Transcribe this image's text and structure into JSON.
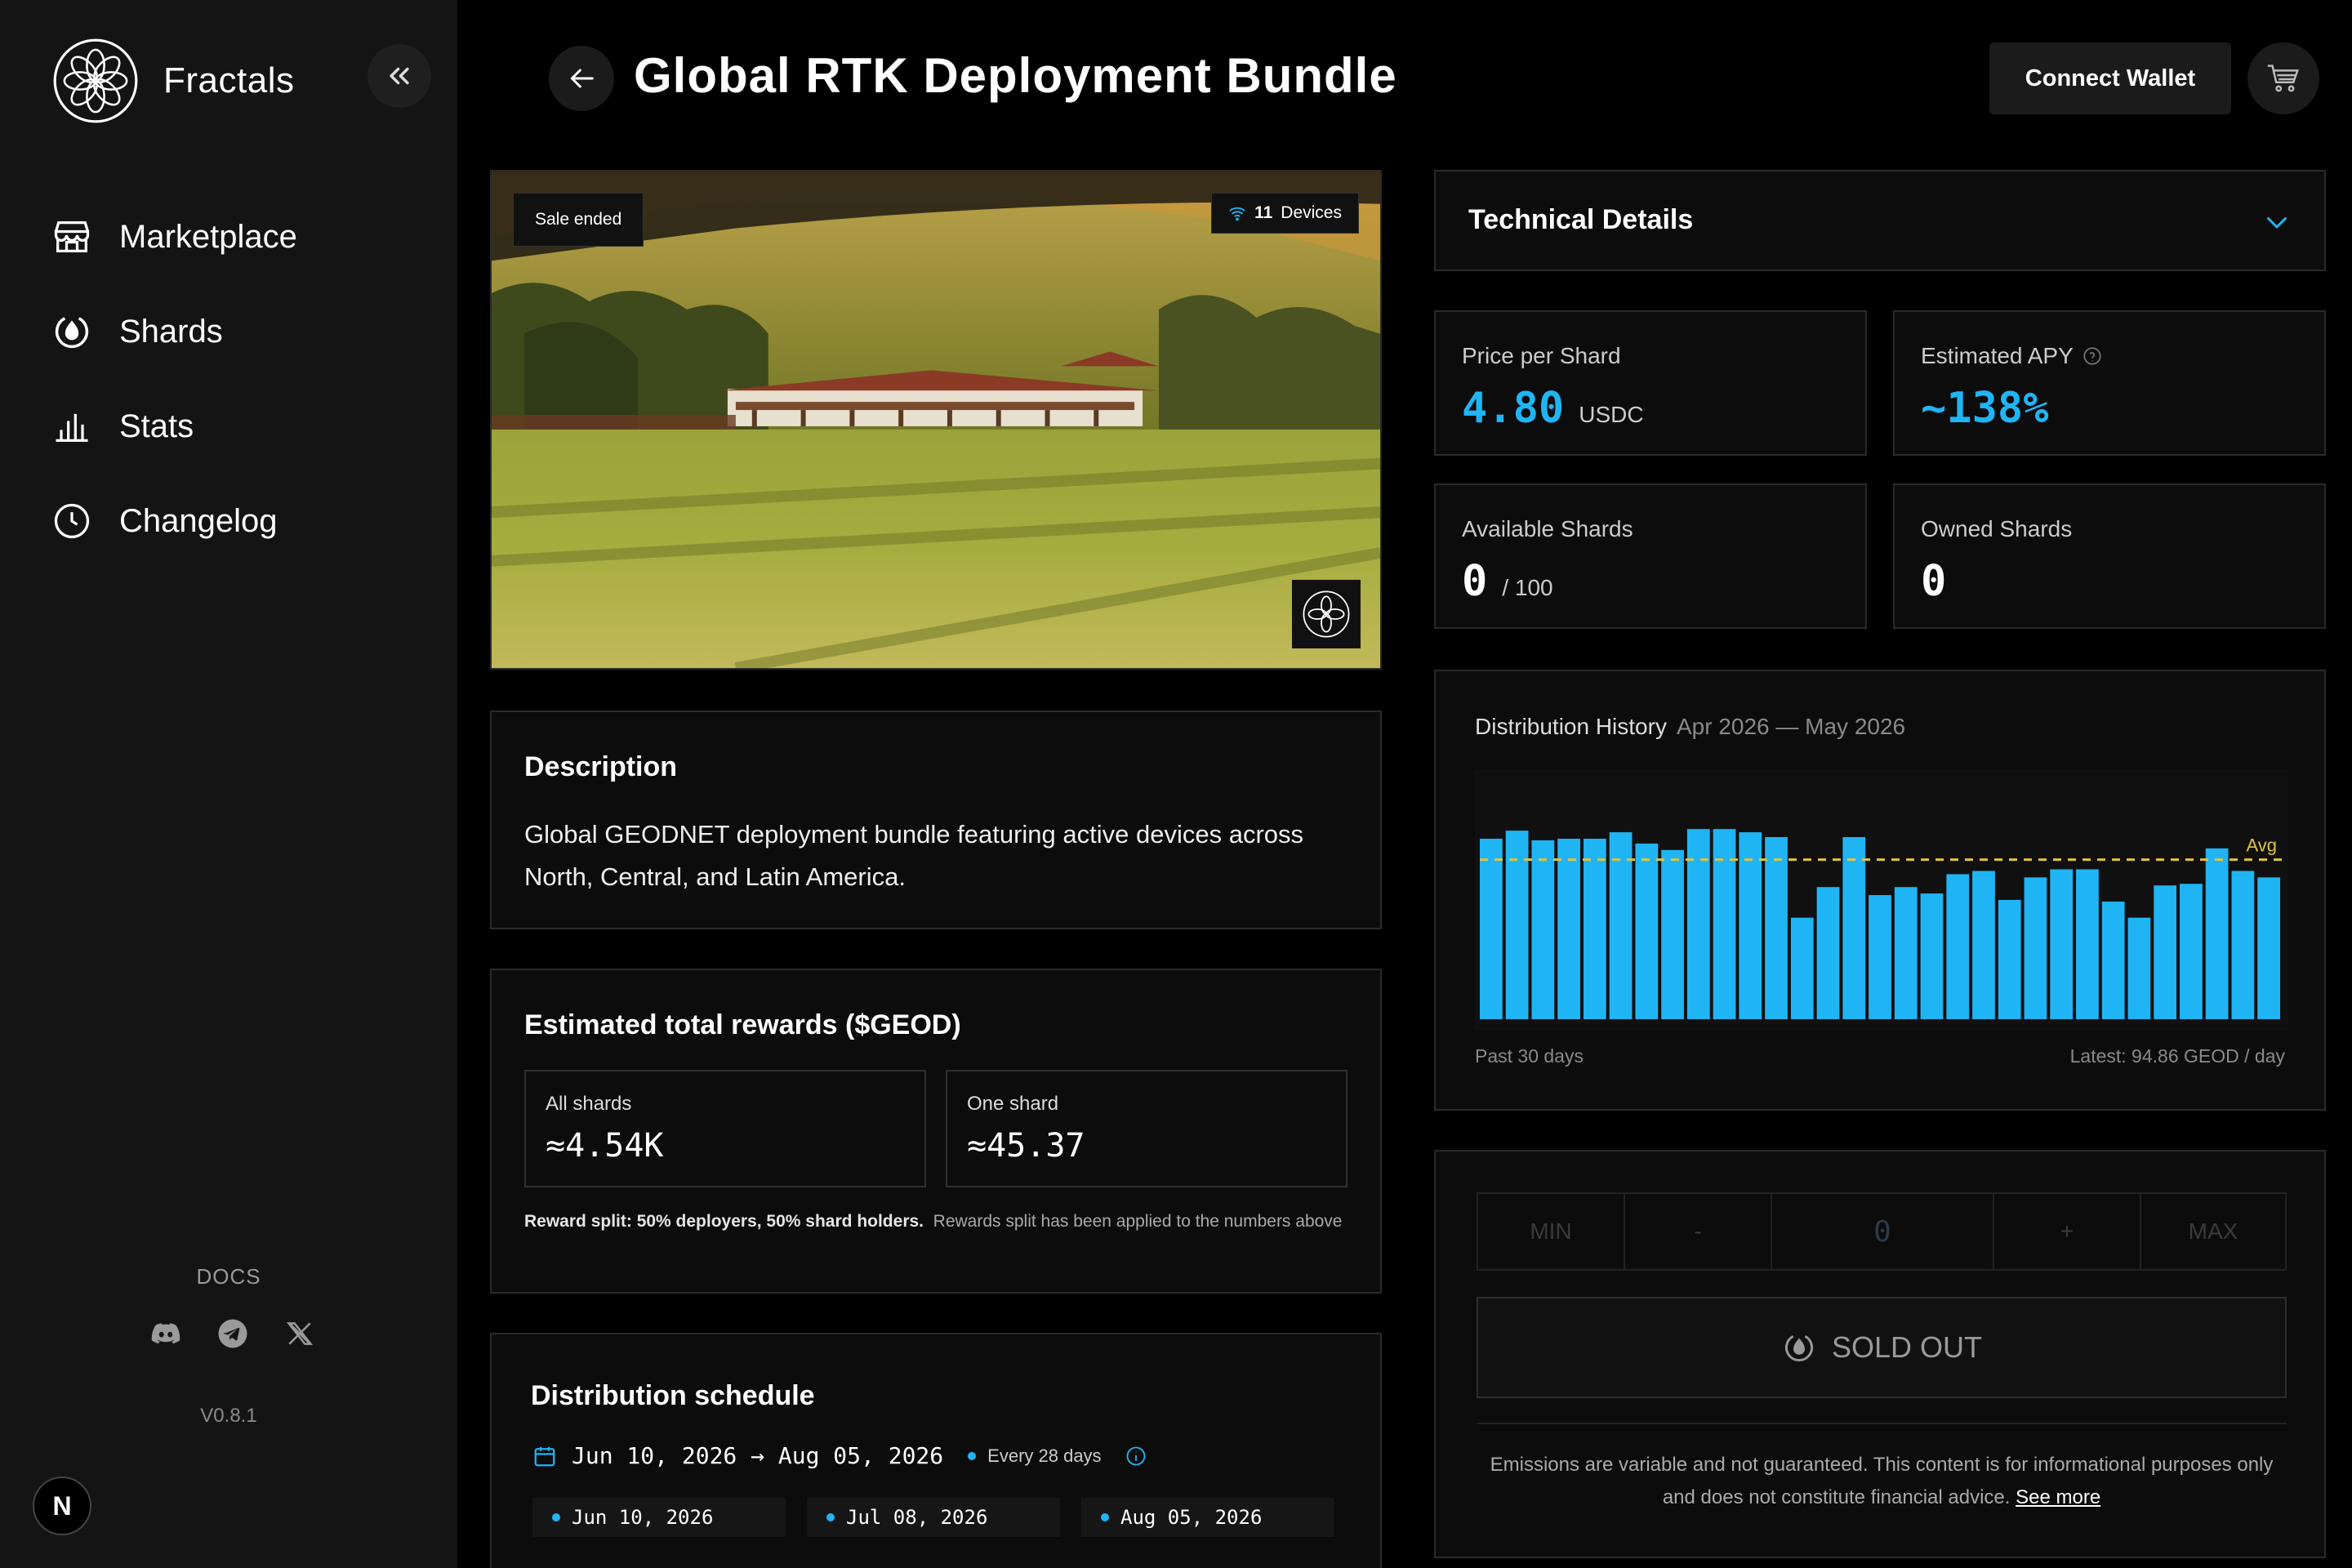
{
  "sidebar": {
    "brand": "Fractals",
    "nav": [
      {
        "label": "Marketplace",
        "icon": "store-icon"
      },
      {
        "label": "Shards",
        "icon": "shard-icon"
      },
      {
        "label": "Stats",
        "icon": "bar-chart-icon"
      },
      {
        "label": "Changelog",
        "icon": "clock-icon"
      }
    ],
    "docs_label": "DOCS",
    "version": "V0.8.1",
    "badge": "N"
  },
  "header": {
    "title": "Global RTK Deployment Bundle",
    "connect_label": "Connect Wallet"
  },
  "hero": {
    "status_badge": "Sale ended",
    "devices_count": "11",
    "devices_label": "Devices"
  },
  "description": {
    "heading": "Description",
    "text": "Global GEODNET deployment bundle featuring active devices across North, Central, and Latin America."
  },
  "rewards": {
    "heading": "Estimated total rewards ($GEOD)",
    "all_label": "All shards",
    "all_value": "≈4.54K",
    "one_label": "One shard",
    "one_value": "≈45.37",
    "split_bold": "Reward split: 50% deployers, 50% shard holders.",
    "split_note": "Rewards split has been applied to the numbers above"
  },
  "schedule": {
    "heading": "Distribution schedule",
    "range": "Jun 10, 2026 → Aug 05, 2026",
    "every": "Every 28 days",
    "dates": [
      "Jun 10, 2026",
      "Jul 08, 2026",
      "Aug 05, 2026"
    ]
  },
  "technical": {
    "heading": "Technical Details"
  },
  "stats": {
    "price_label": "Price per Shard",
    "price_value": "4.80",
    "price_unit": "USDC",
    "apy_label": "Estimated APY",
    "apy_value": "~138%",
    "available_label": "Available Shards",
    "available_value": "0",
    "available_total": "/ 100",
    "owned_label": "Owned Shards",
    "owned_value": "0"
  },
  "chart": {
    "title": "Distribution History",
    "range": "Apr 2026 — May 2026",
    "foot_left": "Past 30 days",
    "foot_right": "Latest: 94.86 GEOD / day",
    "avg_label": "Avg"
  },
  "chart_data": {
    "type": "bar",
    "title": "Distribution History",
    "values": [
      112,
      117,
      111,
      112,
      112,
      116,
      109,
      105,
      118,
      118,
      116,
      113,
      63,
      82,
      113,
      77,
      82,
      78,
      90,
      92,
      74,
      88,
      93,
      93,
      73,
      63,
      83,
      84,
      106,
      92,
      88
    ],
    "average": 99,
    "ylim": [
      0,
      150
    ],
    "colors": {
      "bar": "#1fb5f5",
      "avg": "#e2c43a"
    }
  },
  "purchase": {
    "min": "MIN",
    "minus": "-",
    "qty": "0",
    "plus": "+",
    "max": "MAX",
    "sold_out": "SOLD OUT",
    "disclaimer": "Emissions are variable and not guaranteed. This content is for informational purposes only and does not constitute financial advice.",
    "see_more": "See more"
  }
}
